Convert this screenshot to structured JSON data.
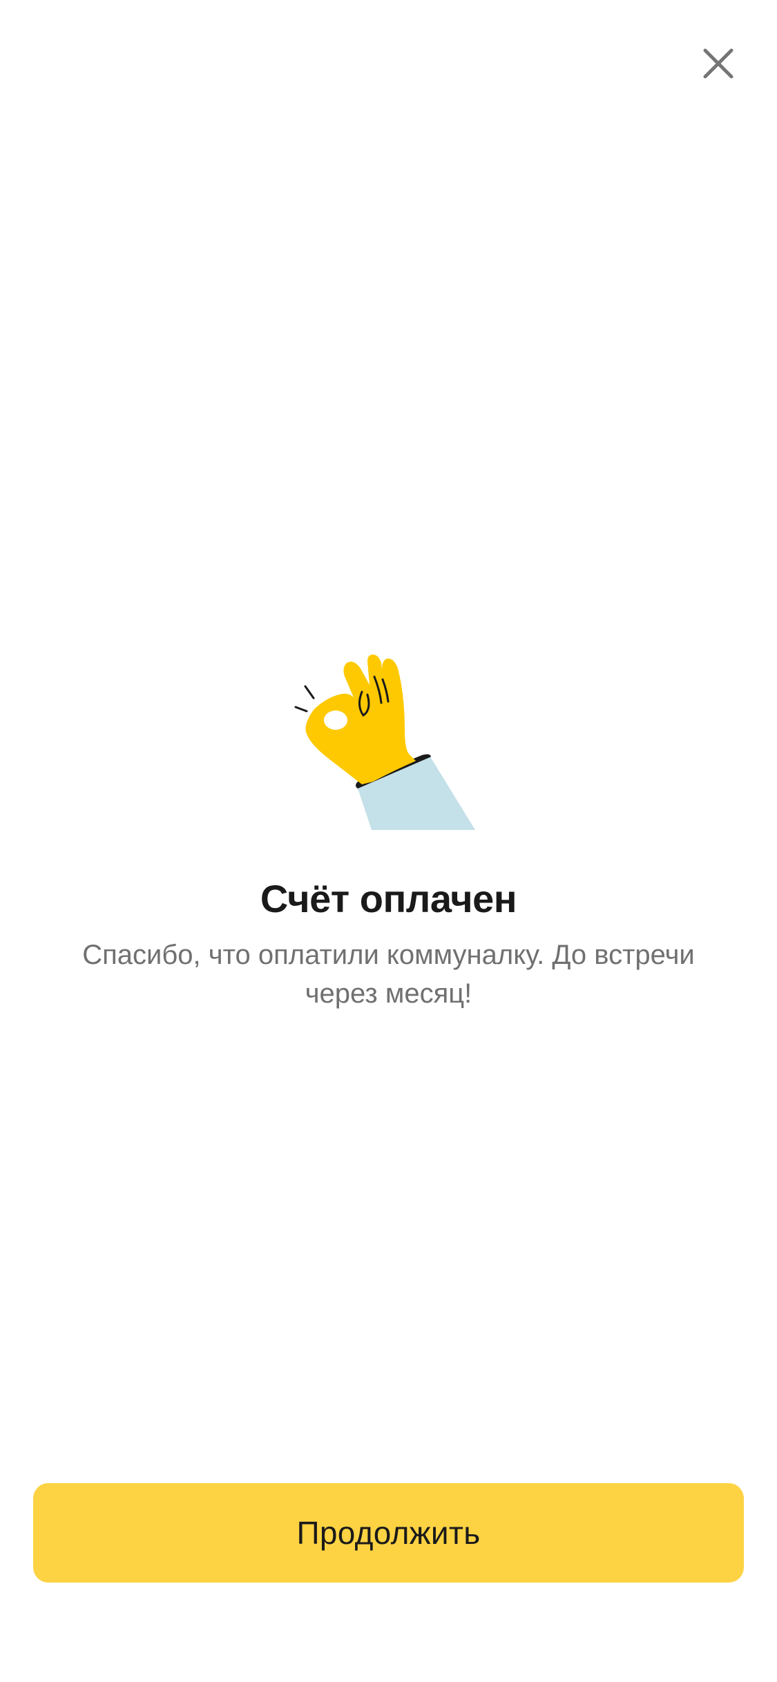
{
  "header": {
    "close_icon": "close-icon"
  },
  "illustration": {
    "icon": "ok-hand-icon",
    "colors": {
      "hand": "#fec900",
      "sleeve": "#c4e0e8",
      "outline": "#1a1a1a"
    }
  },
  "content": {
    "title": "Счёт оплачен",
    "subtitle": "Спасибо, что оплатили коммуналку. До встречи через месяц!"
  },
  "footer": {
    "continue_label": "Продолжить",
    "accent_color": "#fdd343"
  }
}
